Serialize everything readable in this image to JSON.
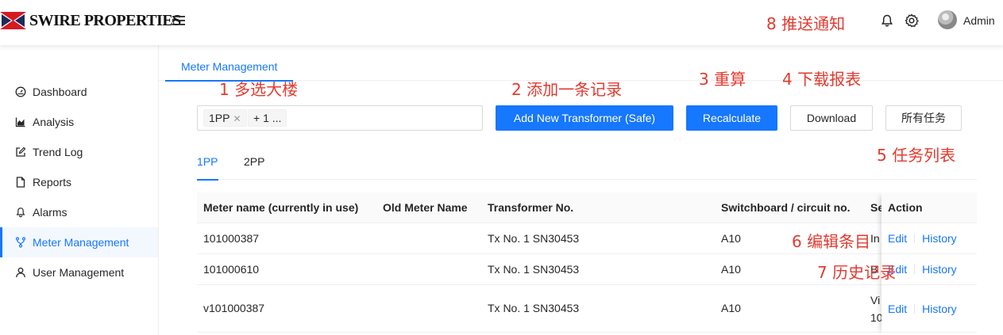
{
  "header": {
    "brand": "SWIRE PROPERTIES",
    "user_name": "Admin",
    "annotation": "8 推送通知"
  },
  "sidebar": {
    "items": [
      {
        "label": "Dashboard",
        "icon": "dashboard-icon",
        "active": false
      },
      {
        "label": "Analysis",
        "icon": "area-chart-icon",
        "active": false
      },
      {
        "label": "Trend Log",
        "icon": "edit-icon",
        "active": false
      },
      {
        "label": "Reports",
        "icon": "file-icon",
        "active": false
      },
      {
        "label": "Alarms",
        "icon": "bell-icon",
        "active": false
      },
      {
        "label": "Meter Management",
        "icon": "branches-icon",
        "active": true
      },
      {
        "label": "User Management",
        "icon": "user-icon",
        "active": false
      }
    ]
  },
  "main": {
    "page_tab": "Meter Management",
    "building_select": {
      "tags": [
        "1PP",
        "+ 1 ..."
      ]
    },
    "buttons": {
      "add": "Add New Transformer (Safe)",
      "recalculate": "Recalculate",
      "download": "Download",
      "tasks": "所有任务"
    },
    "sub_tabs": [
      "1PP",
      "2PP"
    ],
    "active_sub_tab": "1PP",
    "table": {
      "columns": [
        "Meter name (currently in use)",
        "Old Meter Name",
        "Transformer No.",
        "Switchboard / circuit no.",
        "Se",
        "Action"
      ],
      "rows": [
        {
          "meter": "101000387",
          "old": "",
          "transformer": "Tx No. 1 SN30453",
          "switchboard": "A10",
          "se": "In"
        },
        {
          "meter": "101000610",
          "old": "",
          "transformer": "Tx No. 1 SN30453",
          "switchboard": "A10",
          "se": "B"
        },
        {
          "meter": "v101000387",
          "old": "",
          "transformer": "Tx No. 1 SN30453",
          "switchboard": "A10",
          "se": "Vi",
          "se2": "10"
        }
      ],
      "action_edit": "Edit",
      "action_history": "History"
    }
  },
  "annotations": {
    "a1": "1 多选大楼",
    "a2": "2 添加一条记录",
    "a3": "3 重算",
    "a4": "4 下载报表",
    "a5": "5 任务列表",
    "a6": "6 编辑条目",
    "a7": "7 历史记录"
  },
  "colors": {
    "primary": "#1677ff",
    "annotation": "#e23a2f",
    "brand_red": "#d71920",
    "brand_navy": "#1b2a5c"
  }
}
